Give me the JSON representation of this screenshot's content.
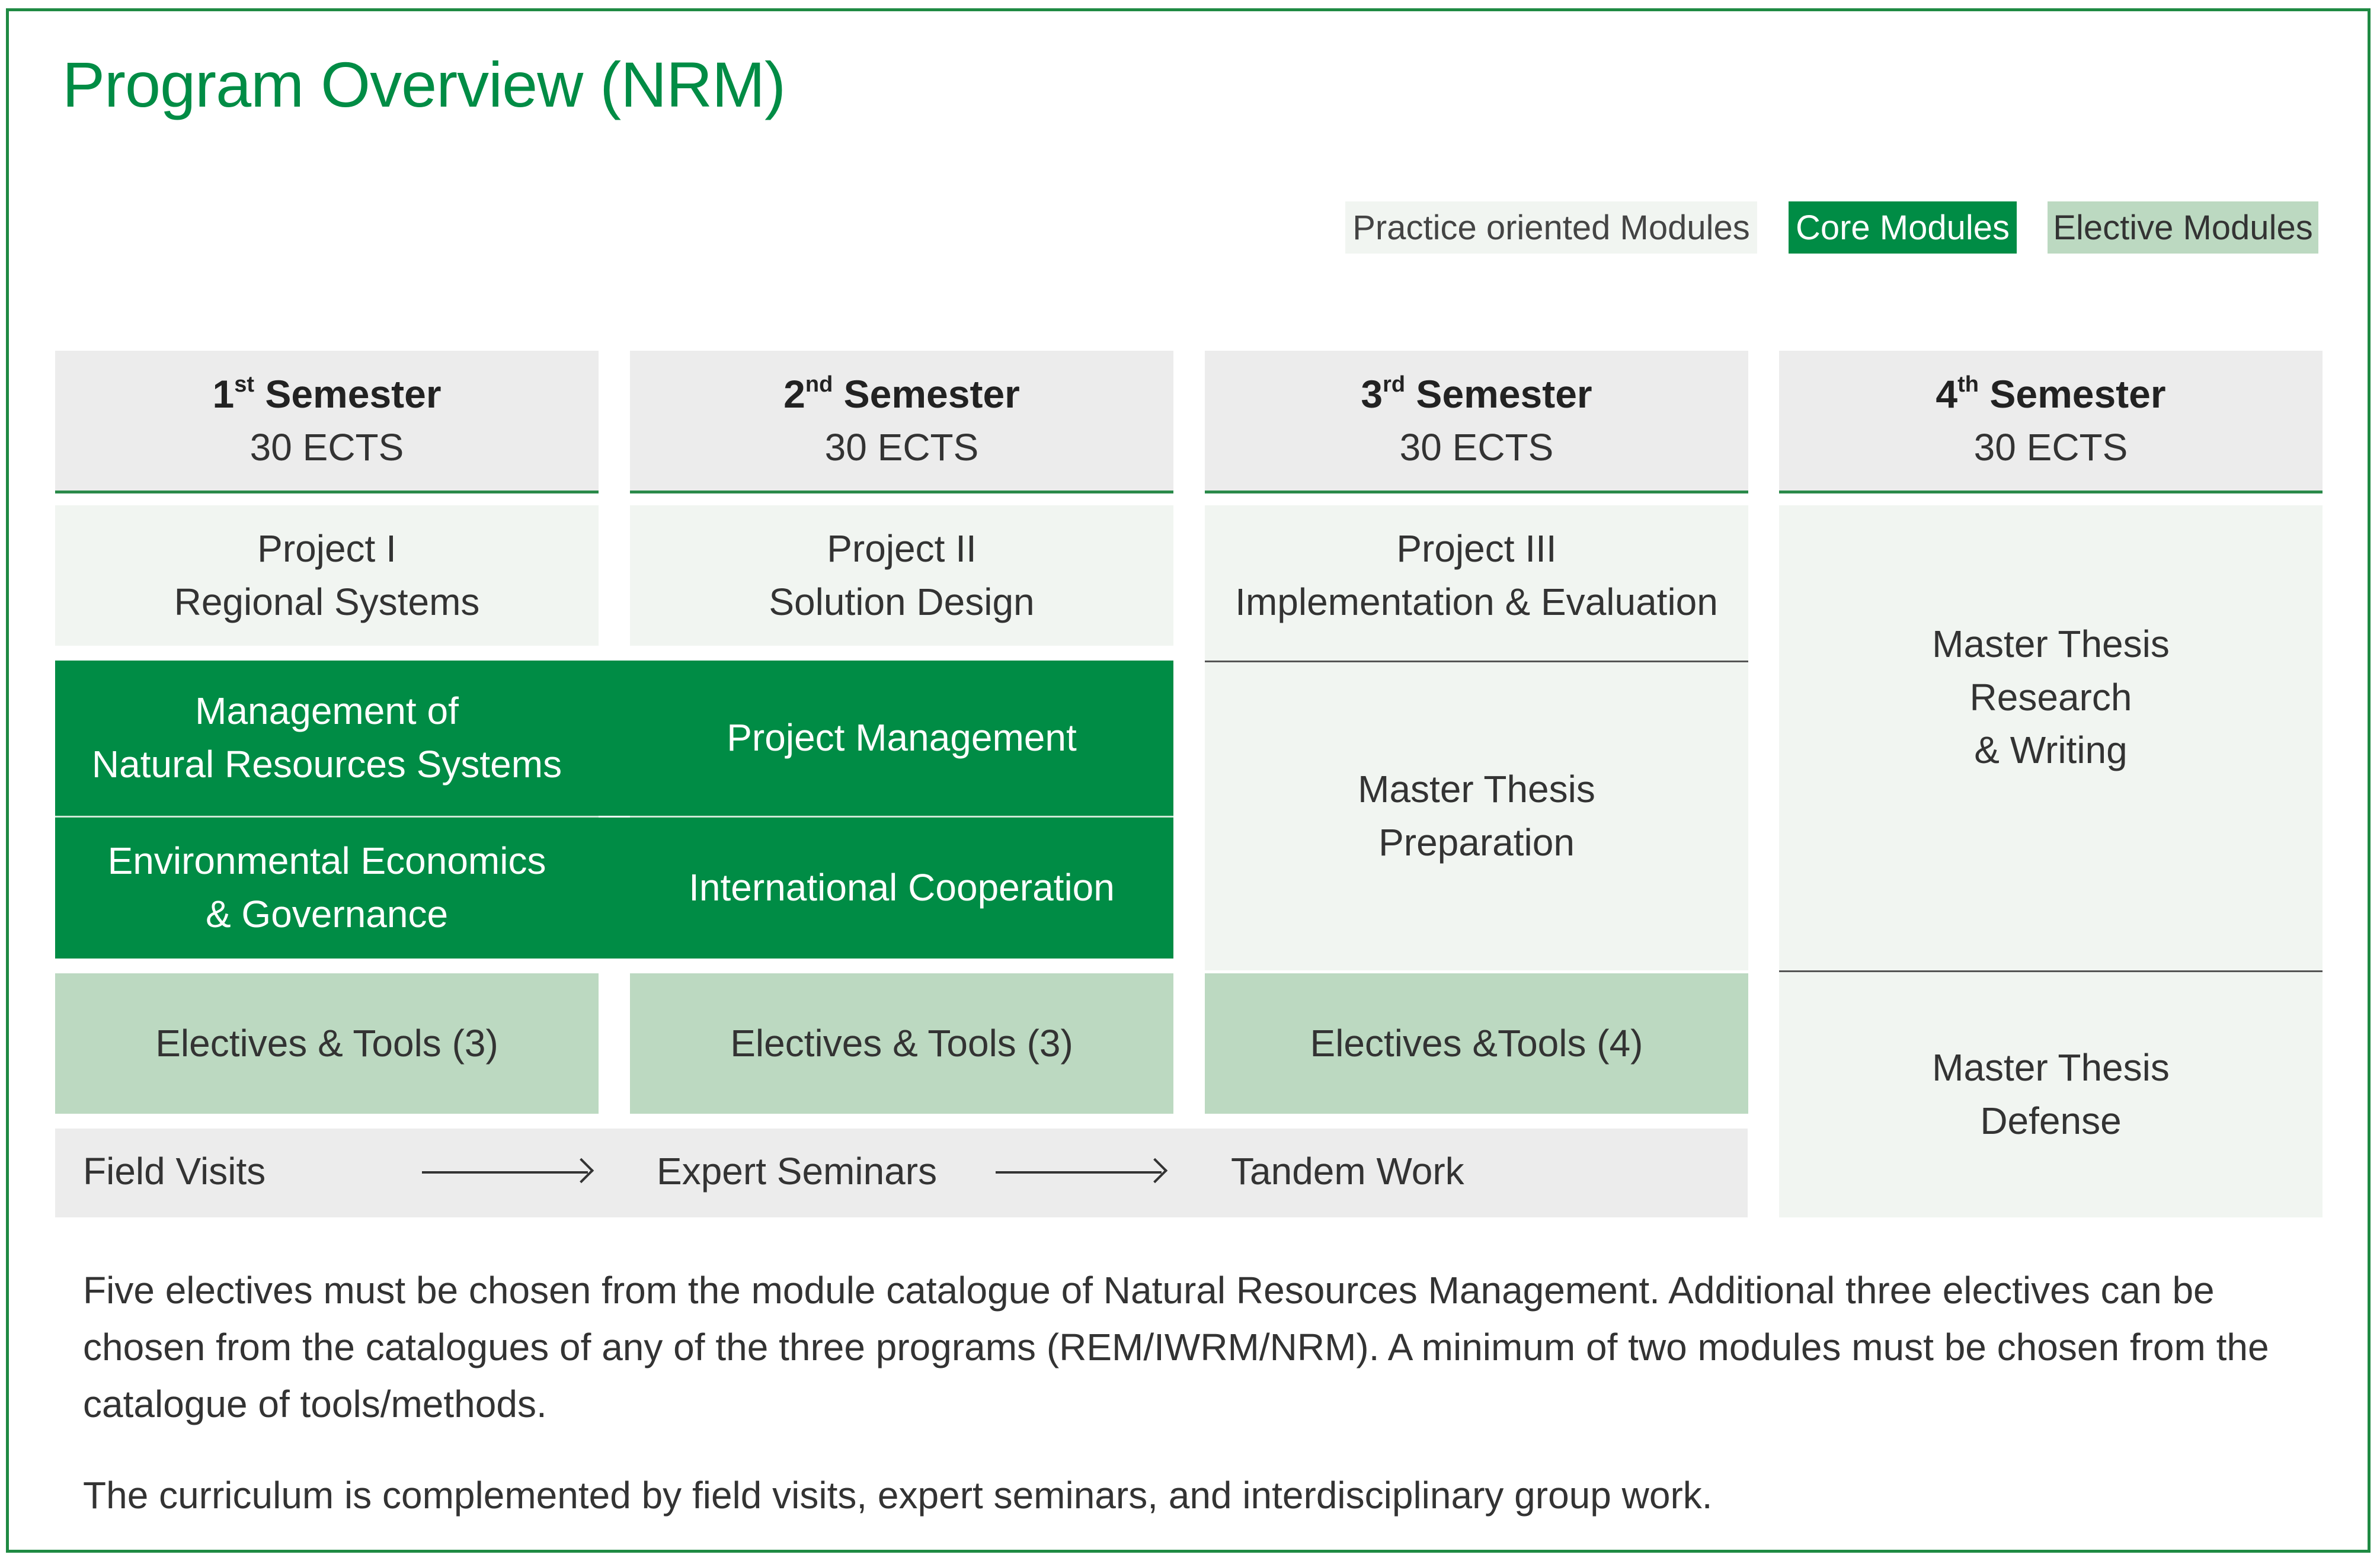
{
  "title": "Program Overview (NRM)",
  "legend": {
    "practice": "Practice oriented Modules",
    "core": "Core Modules",
    "elective": "Elective Modules"
  },
  "colors": {
    "core": "#008c45",
    "elective": "#bcd9c1",
    "practice": "#f1f5f1",
    "header": "#ececec",
    "frame": "#1f8a43"
  },
  "semesters": [
    {
      "num": "1",
      "suffix": "st",
      "label": "Semester",
      "ects": "30 ECTS"
    },
    {
      "num": "2",
      "suffix": "nd",
      "label": "Semester",
      "ects": "30 ECTS"
    },
    {
      "num": "3",
      "suffix": "rd",
      "label": "Semester",
      "ects": "30 ECTS"
    },
    {
      "num": "4",
      "suffix": "th",
      "label": "Semester",
      "ects": "30 ECTS"
    }
  ],
  "projects": [
    {
      "line1": "Project I",
      "line2": "Regional Systems"
    },
    {
      "line1": "Project II",
      "line2": "Solution Design"
    },
    {
      "line1": "Project III",
      "line2": "Implementation & Evaluation"
    }
  ],
  "core_modules": {
    "s1_top": {
      "line1": "Management of",
      "line2": "Natural Resources Systems"
    },
    "s1_bottom": {
      "line1": "Environmental Economics",
      "line2": "& Governance"
    },
    "s2_top": "Project Management",
    "s2_bottom": "International Cooperation"
  },
  "thesis_prep": {
    "line1": "Master Thesis",
    "line2": "Preparation"
  },
  "thesis_research": {
    "line1": "Master Thesis",
    "line2": "Research",
    "line3": "& Writing"
  },
  "thesis_defense": {
    "line1": "Master Thesis",
    "line2": "Defense"
  },
  "electives": [
    "Electives & Tools (3)",
    "Electives & Tools (3)",
    "Electives &Tools (4)"
  ],
  "activities": [
    "Field Visits",
    "Expert Seminars",
    "Tandem Work"
  ],
  "notes": {
    "p1": "Five electives must be chosen from the module catalogue of Natural Resources Management. Additional three electives can be chosen from the catalogues of any of the three programs (REM/IWRM/NRM). A minimum of two modules must be chosen from the catalogue of tools/methods.",
    "p2": "The curriculum is complemented by field visits, expert seminars, and interdisciplinary group work."
  }
}
